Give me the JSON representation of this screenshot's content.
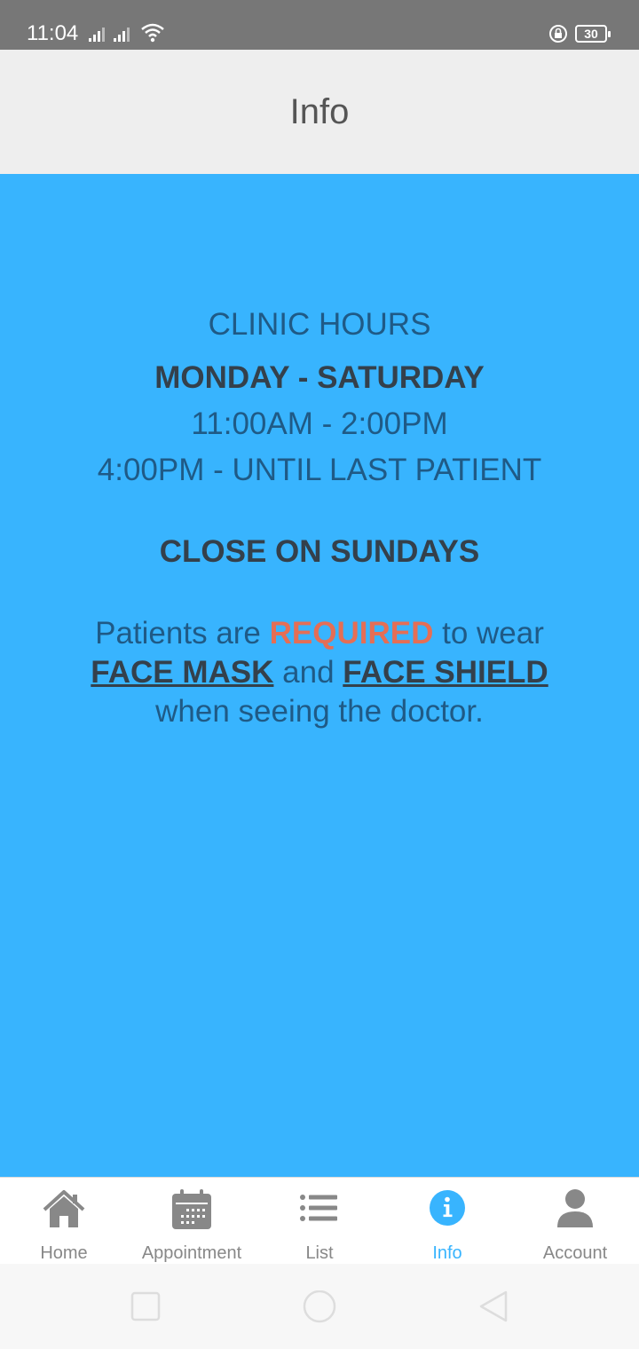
{
  "status_bar": {
    "time": "11:04",
    "battery": "30"
  },
  "header": {
    "title": "Info"
  },
  "content": {
    "hours_heading": "CLINIC HOURS",
    "days": "MONDAY - SATURDAY",
    "time_slot_1": "11:00AM - 2:00PM",
    "time_slot_2": "4:00PM - UNTIL LAST PATIENT",
    "closed": "CLOSE ON SUNDAYS",
    "notice": {
      "part1": "Patients are ",
      "required": "REQUIRED",
      "part2": " to wear",
      "mask": "FACE MASK",
      "and": " and ",
      "shield": "FACE SHIELD",
      "part3": "when seeing the doctor."
    }
  },
  "tabs": [
    {
      "label": "Home",
      "icon": "home-icon"
    },
    {
      "label": "Appointment",
      "icon": "calendar-icon"
    },
    {
      "label": "List",
      "icon": "list-icon"
    },
    {
      "label": "Info",
      "icon": "info-icon",
      "active": true
    },
    {
      "label": "Account",
      "icon": "account-icon"
    }
  ],
  "colors": {
    "accent": "#38b4fe",
    "required": "#e56e55",
    "text_dark": "#34404b",
    "text_blue": "#1f5a86"
  }
}
